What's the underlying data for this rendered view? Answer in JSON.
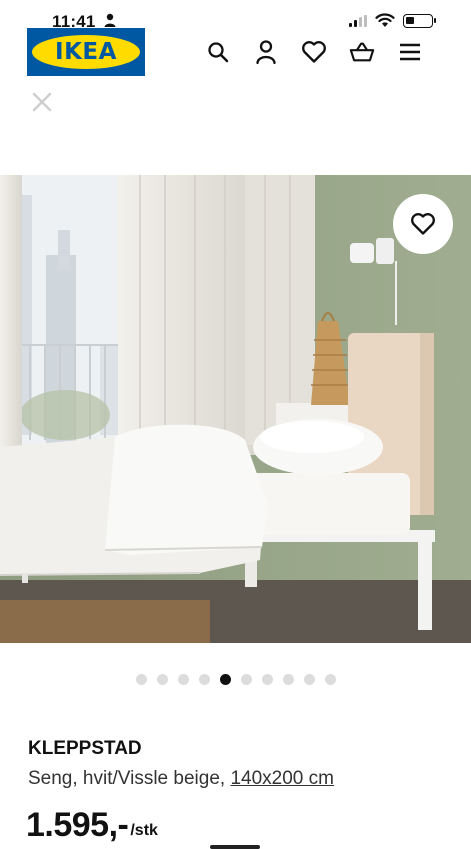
{
  "status_bar": {
    "time": "11:41",
    "icons": [
      "person-icon",
      "signal-icon",
      "wifi-icon",
      "battery-icon"
    ]
  },
  "header": {
    "logo_text": "IKEA",
    "icons": [
      "search-icon",
      "account-icon",
      "heart-icon",
      "basket-icon",
      "menu-icon"
    ]
  },
  "close_icon": "close-icon",
  "product_image": {
    "favorite_icon": "heart-icon",
    "carousel": {
      "total": 10,
      "active_index": 4
    }
  },
  "product": {
    "name": "KLEPPSTAD",
    "description": "Seng, hvit/Vissle beige, ",
    "size": "140x200 cm",
    "price": "1.595,-",
    "price_unit": "/stk"
  },
  "colors": {
    "ikea_blue": "#0058a3",
    "ikea_yellow": "#ffdb00",
    "wall_green": "#97a487",
    "headboard_beige": "#ead7c3"
  }
}
